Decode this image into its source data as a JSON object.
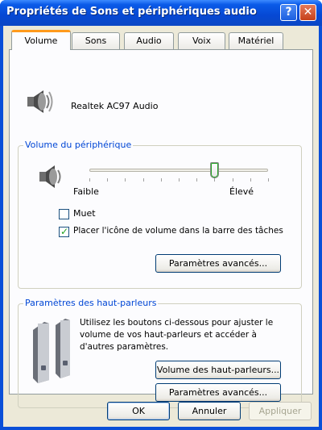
{
  "window": {
    "title": "Propriétés de Sons et périphériques audio",
    "help_glyph": "?",
    "close_glyph": "✕"
  },
  "tabs": [
    "Volume",
    "Sons",
    "Audio",
    "Voix",
    "Matériel"
  ],
  "active_tab": "Volume",
  "device": {
    "name": "Realtek AC97 Audio"
  },
  "device_volume": {
    "group_title": "Volume du périphérique",
    "slider_min_label": "Faible",
    "slider_max_label": "Élevé",
    "level": 0.7,
    "mute_label": "Muet",
    "mute_checked": false,
    "tray_icon_label": "Placer l'icône de volume dans la barre des tâches",
    "tray_icon_checked": true,
    "advanced_button": "Paramètres avancés..."
  },
  "speakers": {
    "group_title": "Paramètres des haut-parleurs",
    "description": "Utilisez les boutons ci-dessous pour ajuster le volume de vos haut-parleurs et accéder à d'autres paramètres.",
    "speaker_volume_button": "Volume des haut-parleurs...",
    "advanced_button": "Paramètres avancés..."
  },
  "footer": {
    "ok": "OK",
    "cancel": "Annuler",
    "apply": "Appliquer"
  }
}
